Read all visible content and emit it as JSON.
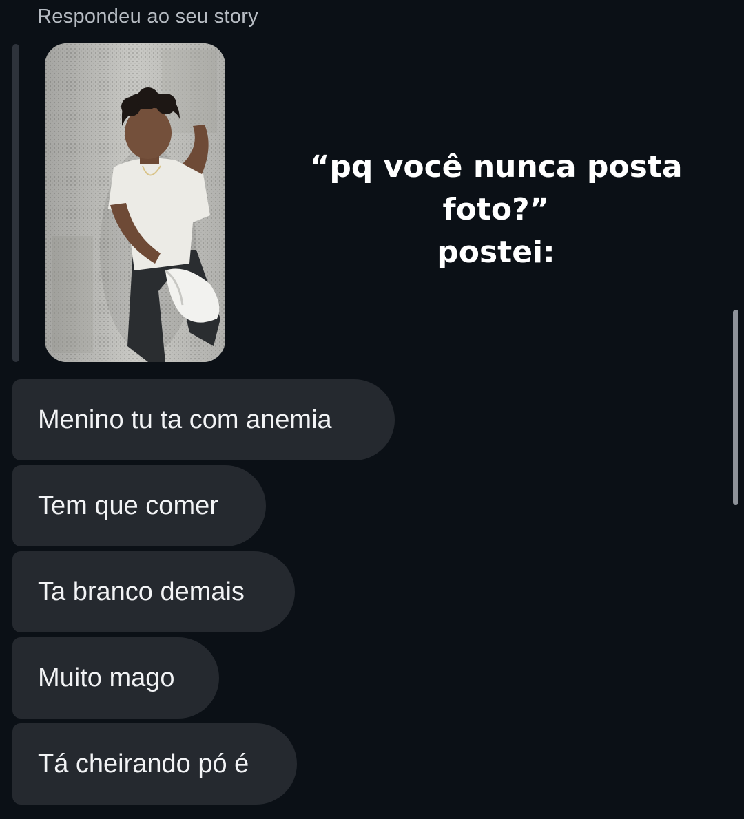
{
  "reply_label": "Respondeu ao seu story",
  "story": {
    "image": "story-photo-person-leaning-on-wall"
  },
  "caption": {
    "line1": "“pq você nunca posta",
    "line2": "foto?”",
    "line3": "postei:"
  },
  "messages": [
    {
      "text": "Menino tu ta com anemia"
    },
    {
      "text": "Tem que comer"
    },
    {
      "text": "Ta branco demais"
    },
    {
      "text": "Muito mago"
    },
    {
      "text": "Tá cheirando pó é"
    }
  ],
  "colors": {
    "background": "#0b1016",
    "bubble": "#25292f",
    "quote_bar": "#2e333b",
    "secondary_text": "#b7bcc3"
  }
}
